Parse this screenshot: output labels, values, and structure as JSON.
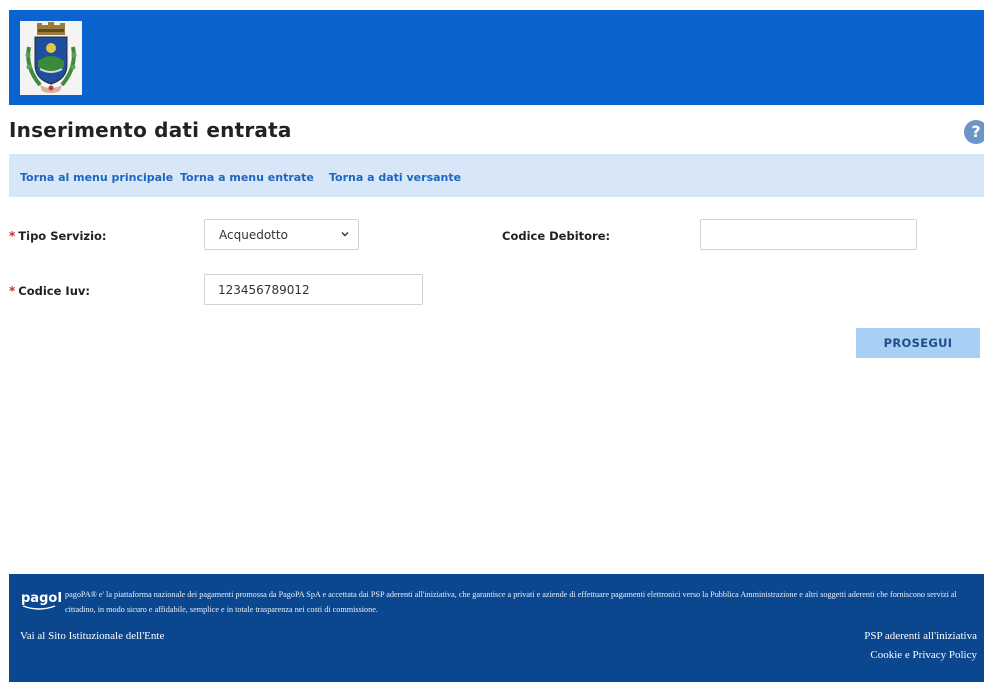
{
  "header": {
    "logo_icon": "municipal-crest-icon"
  },
  "page": {
    "title": "Inserimento dati entrata",
    "help_icon": "?"
  },
  "nav": {
    "links": [
      "Torna al menu principale",
      "Torna a menu entrate",
      "Torna a dati versante"
    ]
  },
  "form": {
    "required_mark": "*",
    "tipo_servizio_label": "Tipo Servizio:",
    "tipo_servizio_value": "Acquedotto",
    "codice_debitore_label": "Codice Debitore:",
    "codice_debitore_value": "",
    "codice_iuv_label": "Codice Iuv:",
    "codice_iuv_value": "123456789012",
    "proceed_label": "PROSEGUI"
  },
  "footer": {
    "logo_text": "pagoPA",
    "description": "pagoPA® e' la piattaforma nazionale dei pagamenti promossa da PagoPA SpA e accettata dai PSP aderenti all'iniziativa, che garantisce a privati e aziende di effettuare pagamenti elettronici verso la Pubblica Amministrazione e altri soggetti aderenti che forniscono servizi al cittadino, in modo sicuro e affidabile, semplice e in totale trasparenza nei costi di commissione.",
    "site_link": "Vai al Sito Istituzionale dell'Ente",
    "psp_link": "PSP aderenti all'iniziativa",
    "privacy_link": "Cookie e Privacy Policy"
  },
  "colors": {
    "header_blue": "#0a63cf",
    "nav_bg": "#d7e7f8",
    "link_blue": "#1f66c0",
    "required_red": "#d02b2b",
    "button_bg": "#a8d0f4",
    "footer_bg": "#0b478f"
  }
}
